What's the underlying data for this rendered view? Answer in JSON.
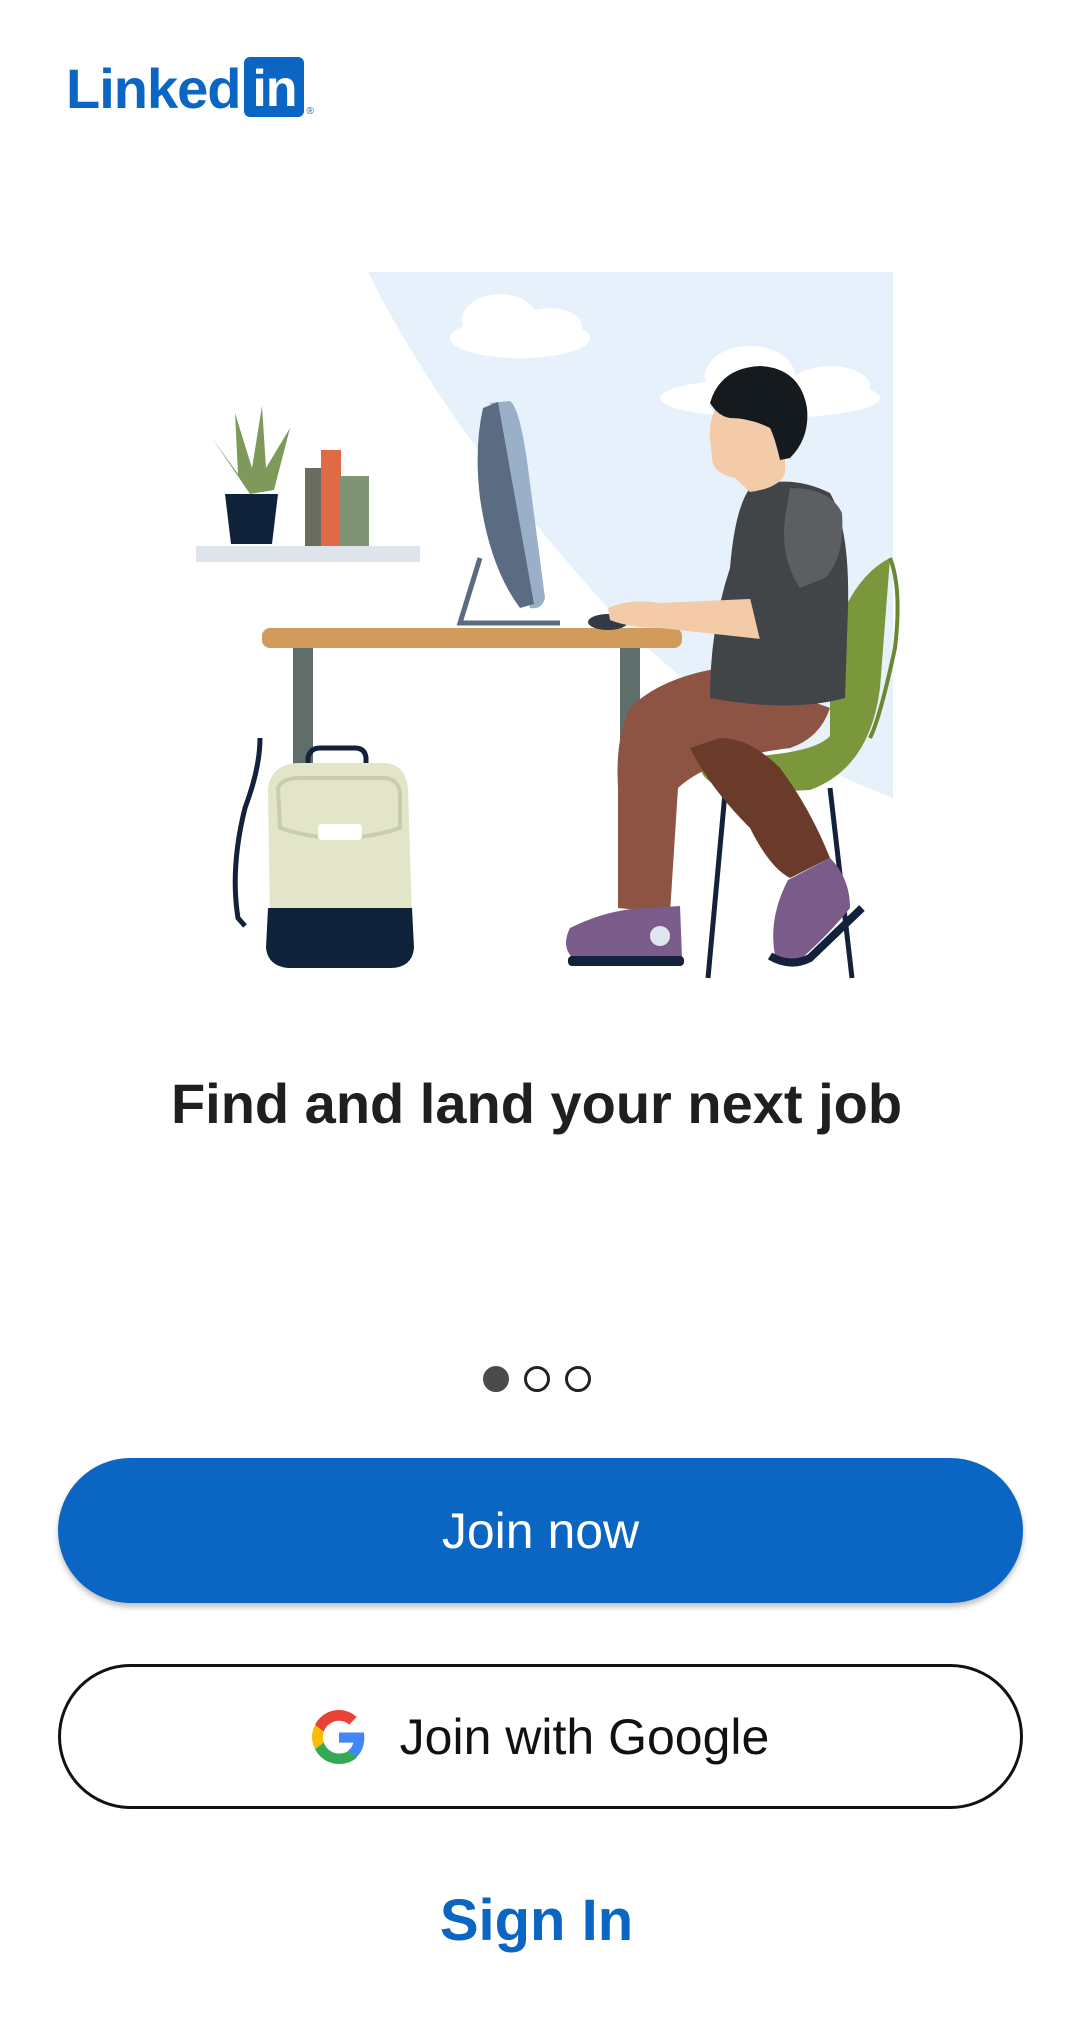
{
  "brand": {
    "word": "Linked",
    "box": "in",
    "registered": "®",
    "color": "#0a66c2"
  },
  "hero": {
    "headline": "Find and land your next job"
  },
  "carousel": {
    "total_pages": 3,
    "active_page": 1
  },
  "actions": {
    "join_now_label": "Join now",
    "join_google_label": "Join with Google",
    "sign_in_label": "Sign In"
  },
  "icons": {
    "google": "google-g-icon"
  }
}
